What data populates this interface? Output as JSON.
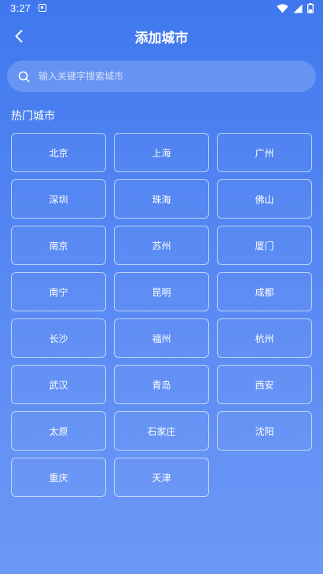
{
  "status_bar": {
    "time": "3:27"
  },
  "header": {
    "title": "添加城市",
    "back_icon": "chevron-left-icon"
  },
  "search": {
    "placeholder": "输入关键字搜索城市",
    "value": "",
    "icon": "search-icon"
  },
  "hot_cities": {
    "title": "热门城市",
    "items": [
      {
        "label": "北京"
      },
      {
        "label": "上海"
      },
      {
        "label": "广州"
      },
      {
        "label": "深圳"
      },
      {
        "label": "珠海"
      },
      {
        "label": "佛山"
      },
      {
        "label": "南京"
      },
      {
        "label": "苏州"
      },
      {
        "label": "厦门"
      },
      {
        "label": "南宁"
      },
      {
        "label": "昆明"
      },
      {
        "label": "成都"
      },
      {
        "label": "长沙"
      },
      {
        "label": "福州"
      },
      {
        "label": "杭州"
      },
      {
        "label": "武汉"
      },
      {
        "label": "青岛"
      },
      {
        "label": "西安"
      },
      {
        "label": "太原"
      },
      {
        "label": "石家庄"
      },
      {
        "label": "沈阳"
      },
      {
        "label": "重庆"
      },
      {
        "label": "天津"
      }
    ]
  },
  "colors": {
    "background_top": "#3f78ee",
    "background_bottom": "#6d98f6",
    "text": "#ffffff"
  }
}
